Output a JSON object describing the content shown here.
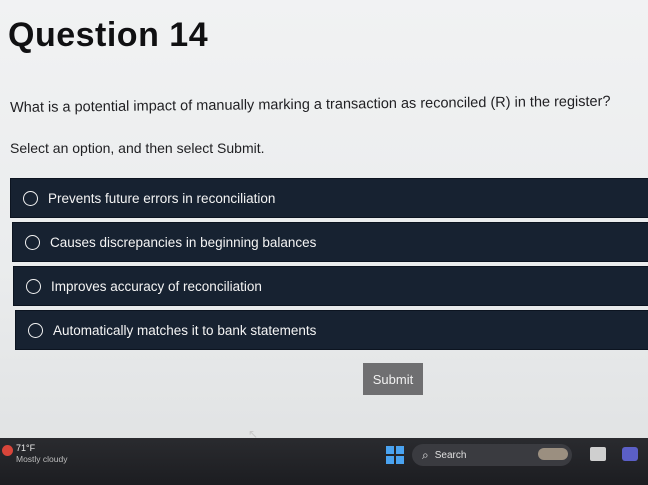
{
  "page": {
    "title": "Question 14",
    "question": "What is a potential impact of manually marking a transaction as reconciled (R) in the register?",
    "instruction": "Select an option, and then select Submit."
  },
  "options": [
    {
      "label": "Prevents future errors in reconciliation"
    },
    {
      "label": "Causes discrepancies in beginning balances"
    },
    {
      "label": "Improves accuracy of reconciliation"
    },
    {
      "label": "Automatically matches it to bank statements"
    }
  ],
  "submit_label": "Submit",
  "taskbar": {
    "temperature": "71°F",
    "weather": "Mostly cloudy",
    "search_label": "Search",
    "icons": [
      "weather-icon",
      "windows-start-icon",
      "search-icon",
      "widget-icon",
      "file-explorer-icon",
      "teams-icon"
    ]
  },
  "colors": {
    "option_background": "#172231",
    "submit_background": "#6f6f71",
    "taskbar_background": "#1c1d21"
  }
}
